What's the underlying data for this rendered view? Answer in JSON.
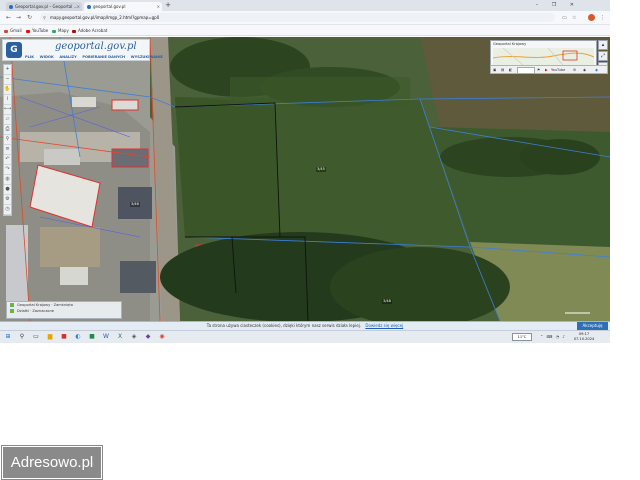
{
  "browser": {
    "tabs": [
      {
        "title": "Geoportal.gov.pl – Geoportal ...",
        "active": false
      },
      {
        "title": "geoportal.gov.pl",
        "active": true
      }
    ],
    "new_tab_label": "+",
    "window_controls": "– ❐ ✕",
    "url": "mapy.geoportal.gov.pl/imap/Imgp_2.html?gpmap=gp0",
    "profile_initial": "",
    "bookmarks": [
      {
        "label": "Gmail",
        "color": "#d44638"
      },
      {
        "label": "YouTube",
        "color": "#ff0000"
      },
      {
        "label": "Mapy",
        "color": "#34a853"
      },
      {
        "label": "Adobe Acrobat",
        "color": "#b30b00"
      }
    ]
  },
  "geoportal": {
    "logo_text": "geoportal.gov.pl",
    "menu": [
      "PLIK",
      "WIDOK",
      "ANALIZY",
      "POBIERANIE DANYCH",
      "WYSZUKIWANIE"
    ],
    "overview_title": "Geoportal Krajowy",
    "layerbar": {
      "select_value": "",
      "youtube_label": "YouTube"
    },
    "legend": [
      {
        "label": "Geoportal Krajowy · Zamknięta"
      },
      {
        "label": "Działki · Zaznaczone"
      }
    ],
    "plot_labels": [
      "3/45",
      "3/46",
      "3/48"
    ]
  },
  "cookie": {
    "message": "Ta strona używa ciasteczek (cookies), dzięki którym nasz serwis działa lepiej.",
    "link": "Dowiedz się więcej",
    "accept": "Akceptuję"
  },
  "taskbar": {
    "weather": "11°C",
    "time": "09:17",
    "date": "07.10.2024"
  },
  "watermark": "Adresowo.pl"
}
